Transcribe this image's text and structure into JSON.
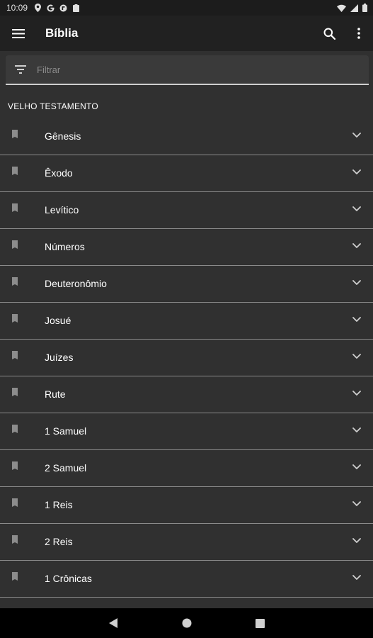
{
  "status_bar": {
    "time": "10:09"
  },
  "app_bar": {
    "title": "Bíblia"
  },
  "filter": {
    "placeholder": "Filtrar",
    "value": ""
  },
  "section": {
    "title": "VELHO TESTAMENTO"
  },
  "books": [
    {
      "name": "Gênesis"
    },
    {
      "name": "Êxodo"
    },
    {
      "name": "Levítico"
    },
    {
      "name": "Números"
    },
    {
      "name": "Deuteronômio"
    },
    {
      "name": "Josué"
    },
    {
      "name": "Juízes"
    },
    {
      "name": "Rute"
    },
    {
      "name": "1 Samuel"
    },
    {
      "name": "2 Samuel"
    },
    {
      "name": "1 Reis"
    },
    {
      "name": "2 Reis"
    },
    {
      "name": "1 Crônicas"
    }
  ],
  "icons": {
    "menu": "hamburger-icon",
    "search": "search-icon",
    "more": "more-vertical-icon",
    "filter": "filter-icon",
    "book": "book-icon",
    "expand": "chevron-down-icon"
  },
  "colors": {
    "background": "#303030",
    "app_bar": "#212121",
    "filter_field": "#3a3a3a",
    "divider": "#8a8a8a",
    "text": "#ffffff"
  }
}
